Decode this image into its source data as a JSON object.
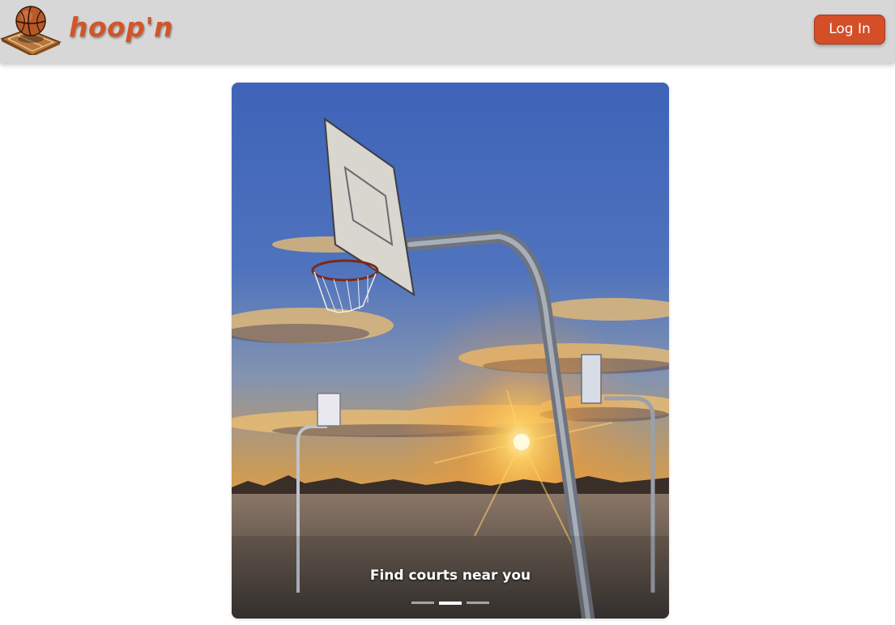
{
  "navbar": {
    "brand_name": "hoop'n",
    "brand_logo_icon": "basketball-court-icon",
    "login_label": "Log In"
  },
  "colors": {
    "navbar_bg": "#d7d7d7",
    "accent": "#d44e28",
    "brand_text": "#d2552a"
  },
  "carousel": {
    "slides": [
      {
        "caption": ""
      },
      {
        "caption": "Find courts near you",
        "image": "outdoor basketball hoop at sunset"
      },
      {
        "caption": ""
      }
    ],
    "active_index": 1,
    "current_caption": "Find courts near you"
  }
}
